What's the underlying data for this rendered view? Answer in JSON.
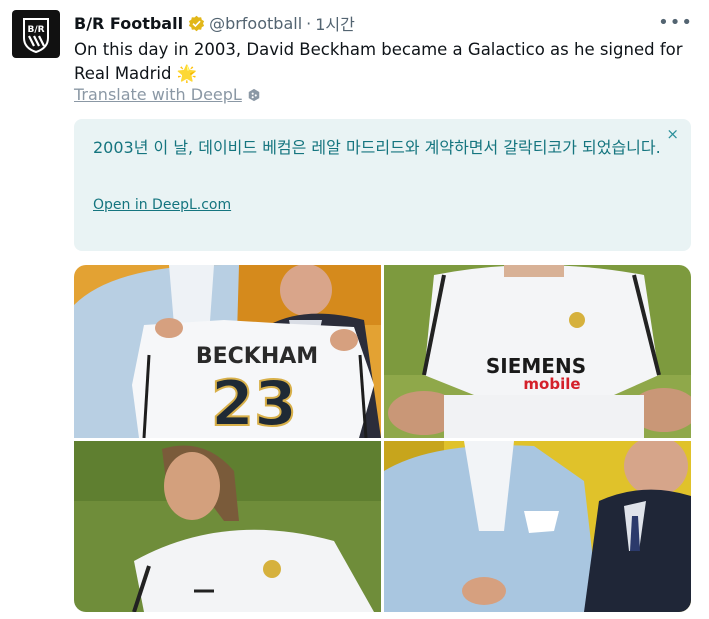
{
  "author": {
    "name": "B/R Football",
    "handle": "@brfootball",
    "separator": "·",
    "time": "1시간",
    "avatar_text": "B/R"
  },
  "more_label": "•••",
  "tweet": {
    "text": "On this day in 2003, David Beckham became a Galactico as he signed for Real Madrid",
    "emoji": "🌟"
  },
  "translate": {
    "label": "Translate with DeepL"
  },
  "deepl": {
    "translation": "2003년 이 날, 데이비드 베컴은 레알 마드리드와 계약하면서 갈락티코가 되었습니다.",
    "link_label": "Open in DeepL.com",
    "close_label": "×"
  },
  "media": {
    "photo1": {
      "shirt_name": "BECKHAM",
      "shirt_number": "23"
    },
    "photo2": {
      "sponsor_top": "SIEMENS",
      "sponsor_bottom": "mobile"
    }
  },
  "colors": {
    "accent_deepl": "#15757f",
    "deepl_bg": "#e9f3f4",
    "verified_gold": "#e2b719",
    "muted": "#536471"
  }
}
